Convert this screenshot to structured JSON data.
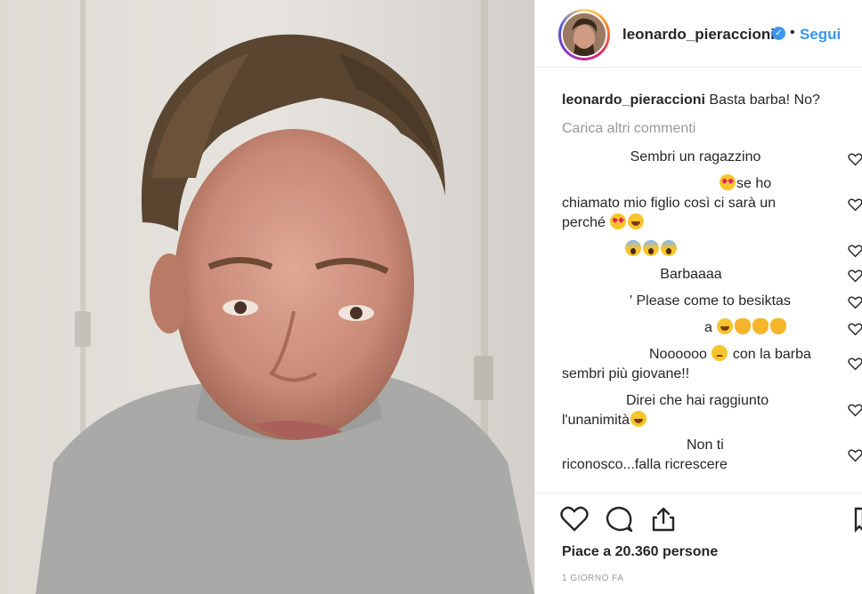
{
  "post": {
    "username": "leonardo_pieraccioni",
    "verified_icon": "verified-badge-icon",
    "separator": "•",
    "follow_label": "Segui",
    "caption_text": "Basta barba! No?",
    "load_more": "Carica altri commenti",
    "likes_text": "Piace a 20.360 persone",
    "time": "1 GIORNO FA"
  },
  "comments": [
    {
      "text": "Sembri un ragazzino"
    },
    {
      "line1": "se ho",
      "line2": "chiamato mio figlio così ci sarà un",
      "line3": "perché",
      "emoji": [
        "heart-eyes",
        "heart-eyes",
        "rofl"
      ]
    },
    {
      "emoji": [
        "scream",
        "scream",
        "scream"
      ]
    },
    {
      "text": "Barbaaaa"
    },
    {
      "text": "' Please come to besiktas"
    },
    {
      "text": "a",
      "emoji": [
        "joy",
        "clap",
        "clap",
        "clap"
      ]
    },
    {
      "line1a": "Noooooo",
      "line1b": "con la barba",
      "line2": "sembri più giovane!!",
      "emoji": [
        "pensive"
      ]
    },
    {
      "line1": "Direi che hai raggiunto",
      "line2": "l'unanimità",
      "emoji": [
        "joy"
      ]
    },
    {
      "line1": "Non ti",
      "line2": "riconosco...falla ricrescere"
    }
  ],
  "icons": {
    "like": "heart-outline-icon",
    "comment": "comment-bubble-icon",
    "share": "share-icon",
    "save": "bookmark-icon",
    "comment_like": "small-heart-icon"
  },
  "colors": {
    "link": "#3897f0",
    "muted": "#999999",
    "text": "#262626"
  }
}
